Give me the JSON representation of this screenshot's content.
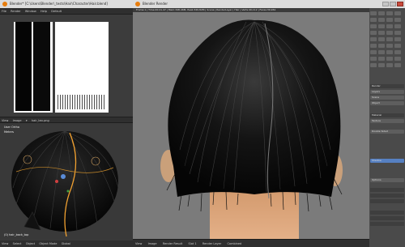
{
  "left_window": {
    "title": "Blender* [C:\\Users\\Blender\\_tests\\Hair\\Character\\Hair.blend]",
    "menu": [
      "File",
      "Render",
      "Window",
      "Help",
      "Default"
    ],
    "image_header": [
      "View",
      "Image",
      "▾",
      "hair_tex.png"
    ],
    "viewport_header": [
      "View",
      "Select",
      "Object",
      "Object Mode",
      "Global"
    ],
    "viewport_text": [
      "User Ortho",
      "Meters",
      "(0) hair_back_top"
    ],
    "bottom_header": [
      "View",
      "Marker",
      "Frame",
      "Playback"
    ]
  },
  "render_window": {
    "title": "Blender Render",
    "info": "Frame:1 | Time:00:21.47 | Mem:348.46M, Peak:349.82M | Scene | RenderLayer | Hair | Verts:40,112 | Faces:39,961",
    "footer": [
      "View",
      "Image",
      "Render Result",
      "Slot 1",
      "Render Layer",
      "Combined"
    ]
  },
  "props": {
    "rows": [
      "Render",
      "Layers",
      "Scene",
      "Object",
      "Material",
      "Texture",
      "Double Sided",
      "Shadow",
      "Options"
    ]
  },
  "colors": {
    "accent": "#e87d0d",
    "selection": "#5680c2",
    "hair_guide": "#f0a030"
  }
}
